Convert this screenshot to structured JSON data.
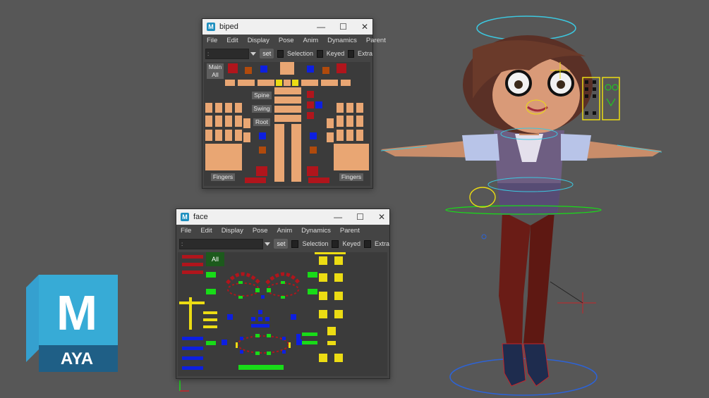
{
  "biped_window": {
    "title": "biped",
    "menu": [
      "File",
      "Edit",
      "Display",
      "Pose",
      "Anim",
      "Dynamics",
      "Parent"
    ],
    "combo_value": ":",
    "set_label": "set",
    "checkboxes": [
      "Selection",
      "Keyed",
      "Extra"
    ],
    "labels": {
      "main": "Main",
      "all": "All",
      "spine": "Spine",
      "swing": "Swing",
      "root": "Root",
      "fingers_left": "Fingers",
      "fingers_right": "Fingers"
    }
  },
  "face_window": {
    "title": "face",
    "menu": [
      "File",
      "Edit",
      "Display",
      "Pose",
      "Anim",
      "Dynamics",
      "Parent"
    ],
    "combo_value": ":",
    "set_label": "set",
    "checkboxes": [
      "Selection",
      "Keyed",
      "Extra"
    ],
    "all_label": "All"
  },
  "window_controls": {
    "minimize": "—",
    "maximize": "☐",
    "close": "✕"
  },
  "logo": {
    "letter": "M",
    "text": "AYA"
  },
  "colors": {
    "skin": "#e9a673",
    "red": "#b0151c",
    "orange": "#b04a0c",
    "blue": "#0d1fe0",
    "yellow": "#ecdc13",
    "green": "#18dc18",
    "maya_blue": "#1e8fbf"
  }
}
